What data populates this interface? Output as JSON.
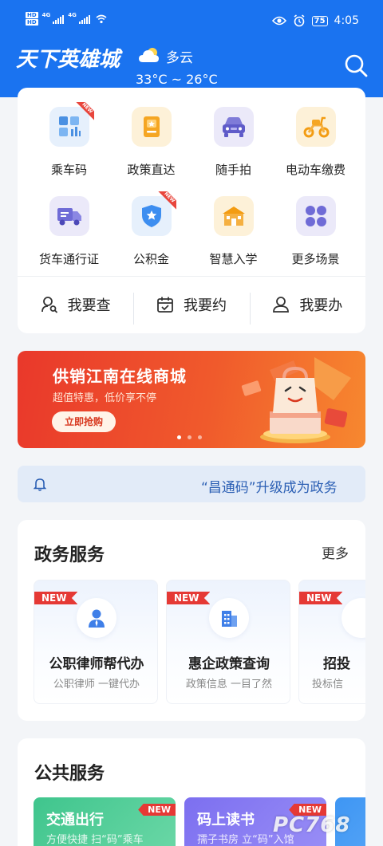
{
  "status_bar": {
    "hd1": "HD",
    "hd2": "HD",
    "net1": "4G",
    "net2": "4G",
    "battery": "75",
    "time": "4:05"
  },
  "header": {
    "logo": "天下英雄城",
    "weather": "多云",
    "temperature": "33°C ~ 26°C"
  },
  "services": {
    "items": [
      {
        "label": "乘车码",
        "icon": "bus-code-icon",
        "new": true
      },
      {
        "label": "政策直达",
        "icon": "policy-icon",
        "new": false
      },
      {
        "label": "随手拍",
        "icon": "car-camera-icon",
        "new": false
      },
      {
        "label": "电动车缴费",
        "icon": "scooter-icon",
        "new": false
      },
      {
        "label": "货车通行证",
        "icon": "truck-icon",
        "new": false
      },
      {
        "label": "公积金",
        "icon": "shield-star-icon",
        "new": true
      },
      {
        "label": "智慧入学",
        "icon": "school-icon",
        "new": false
      },
      {
        "label": "更多场景",
        "icon": "grid-more-icon",
        "new": false
      }
    ],
    "new_label": "NEW"
  },
  "actions": [
    {
      "label": "我要查",
      "icon": "user-search-icon"
    },
    {
      "label": "我要约",
      "icon": "calendar-icon"
    },
    {
      "label": "我要办",
      "icon": "user-icon"
    }
  ],
  "banner": {
    "title": "供销江南在线商城",
    "subtitle": "超值特惠，低价享不停",
    "button": "立即抢购"
  },
  "notice": {
    "text": "“昌通码”升级成为政务"
  },
  "gov_services": {
    "title": "政务服务",
    "more": "更多",
    "new_label": "NEW",
    "tiles": [
      {
        "title": "公职律师帮代办",
        "subtitle": "公职律师 一键代办"
      },
      {
        "title": "惠企政策查询",
        "subtitle": "政策信息 一目了然"
      },
      {
        "title": "招投",
        "subtitle": "投标信"
      }
    ]
  },
  "public_services": {
    "title": "公共服务",
    "new_label": "NEW",
    "tiles": [
      {
        "title": "交通出行",
        "subtitle": "方便快捷 扫“码”乘车"
      },
      {
        "title": "码上读书",
        "subtitle": "孺子书房 立“码”入馆"
      }
    ]
  },
  "watermark": "PC768",
  "colors": {
    "brand_blue": "#1a73f0",
    "new_red": "#e53935",
    "banner_orange": "#f05a2c"
  }
}
